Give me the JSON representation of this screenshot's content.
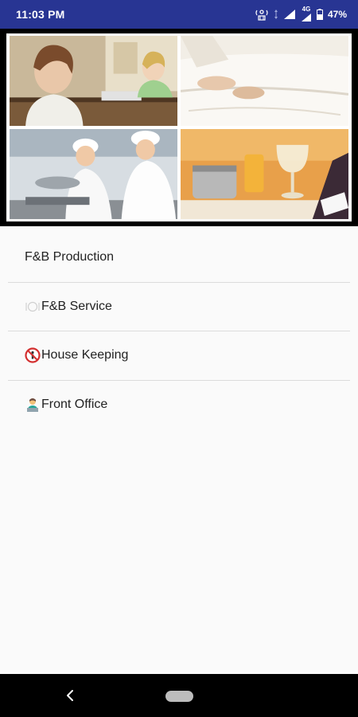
{
  "status_bar": {
    "time": "11:03 PM",
    "network": "4G",
    "battery_percent": "47%",
    "icons": [
      "location-tracker-icon",
      "data-arrows-icon",
      "wifi-signal-icon",
      "cell-signal-icon",
      "battery-icon"
    ]
  },
  "hero": {
    "tiles": [
      {
        "icon": "front-desk-photo"
      },
      {
        "icon": "bed-making-photo"
      },
      {
        "icon": "chefs-cooking-photo"
      },
      {
        "icon": "wine-service-photo"
      }
    ]
  },
  "menu": {
    "items": [
      {
        "label": "F&B Production",
        "icon": ""
      },
      {
        "label": "F&B Service",
        "icon": "fork-knife-plate-icon"
      },
      {
        "label": "House Keeping",
        "icon": "no-entry-sign-icon"
      },
      {
        "label": "Front Office",
        "icon": "person-at-laptop-icon"
      }
    ]
  },
  "nav_bar": {
    "icons": [
      "back-icon",
      "home-pill-icon"
    ]
  },
  "colors": {
    "status_bar": "#283593",
    "background": "#fafafa",
    "divider": "#dcdcdc",
    "nav_bar": "#000000"
  }
}
